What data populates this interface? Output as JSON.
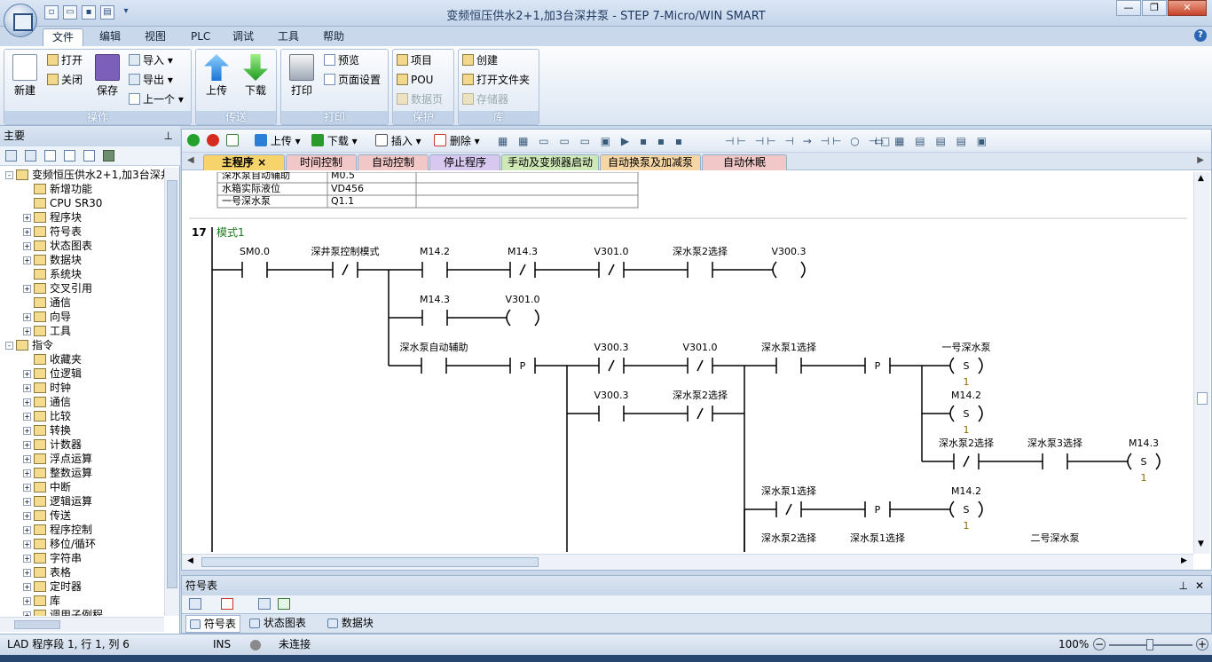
{
  "window": {
    "title": "变频恒压供水2+1,加3台深井泵 - STEP 7-Micro/WIN SMART"
  },
  "menu_tabs": [
    "文件",
    "编辑",
    "视图",
    "PLC",
    "调试",
    "工具",
    "帮助"
  ],
  "ribbon": {
    "groups": [
      {
        "title": "操作",
        "new": "新建",
        "open": "打开",
        "close": "关闭",
        "save": "保存",
        "import": "导入",
        "export": "导出",
        "previous": "上一个"
      },
      {
        "title": "传送",
        "upload": "上传",
        "download": "下载"
      },
      {
        "title": "打印",
        "print": "打印",
        "preview": "预览",
        "page_setup": "页面设置"
      },
      {
        "title": "保护",
        "project": "项目",
        "pou": "POU",
        "datapage": "数据页"
      },
      {
        "title": "库",
        "create": "创建",
        "open_folder": "打开文件夹",
        "memory": "存储器"
      }
    ]
  },
  "left_panel": {
    "title": "主要",
    "tree": [
      {
        "label": "变频恒压供水2+1,加3台深井",
        "level": 0,
        "exp": "-"
      },
      {
        "label": "新增功能",
        "level": 1,
        "exp": ""
      },
      {
        "label": "CPU SR30",
        "level": 1,
        "exp": ""
      },
      {
        "label": "程序块",
        "level": 1,
        "exp": "+"
      },
      {
        "label": "符号表",
        "level": 1,
        "exp": "+"
      },
      {
        "label": "状态图表",
        "level": 1,
        "exp": "+"
      },
      {
        "label": "数据块",
        "level": 1,
        "exp": "+"
      },
      {
        "label": "系统块",
        "level": 1,
        "exp": ""
      },
      {
        "label": "交叉引用",
        "level": 1,
        "exp": "+"
      },
      {
        "label": "通信",
        "level": 1,
        "exp": ""
      },
      {
        "label": "向导",
        "level": 1,
        "exp": "+"
      },
      {
        "label": "工具",
        "level": 1,
        "exp": "+"
      },
      {
        "label": "指令",
        "level": 0,
        "exp": "-"
      },
      {
        "label": "收藏夹",
        "level": 1,
        "exp": ""
      },
      {
        "label": "位逻辑",
        "level": 1,
        "exp": "+"
      },
      {
        "label": "时钟",
        "level": 1,
        "exp": "+"
      },
      {
        "label": "通信",
        "level": 1,
        "exp": "+"
      },
      {
        "label": "比较",
        "level": 1,
        "exp": "+"
      },
      {
        "label": "转换",
        "level": 1,
        "exp": "+"
      },
      {
        "label": "计数器",
        "level": 1,
        "exp": "+"
      },
      {
        "label": "浮点运算",
        "level": 1,
        "exp": "+"
      },
      {
        "label": "整数运算",
        "level": 1,
        "exp": "+"
      },
      {
        "label": "中断",
        "level": 1,
        "exp": "+"
      },
      {
        "label": "逻辑运算",
        "level": 1,
        "exp": "+"
      },
      {
        "label": "传送",
        "level": 1,
        "exp": "+"
      },
      {
        "label": "程序控制",
        "level": 1,
        "exp": "+"
      },
      {
        "label": "移位/循环",
        "level": 1,
        "exp": "+"
      },
      {
        "label": "字符串",
        "level": 1,
        "exp": "+"
      },
      {
        "label": "表格",
        "level": 1,
        "exp": "+"
      },
      {
        "label": "定时器",
        "level": 1,
        "exp": "+"
      },
      {
        "label": "库",
        "level": 1,
        "exp": "+"
      },
      {
        "label": "调用子例程",
        "level": 1,
        "exp": "+"
      }
    ]
  },
  "editor_toolbar": {
    "upload": "上传",
    "download": "下载",
    "insert": "插入",
    "delete": "删除"
  },
  "program_tabs": [
    {
      "label": "主程序",
      "color": "#f7d36b",
      "active": true
    },
    {
      "label": "时间控制",
      "color": "#f1c7c7",
      "active": false
    },
    {
      "label": "自动控制",
      "color": "#f1c7c7",
      "active": false
    },
    {
      "label": "停止程序",
      "color": "#d8c8f0",
      "active": false
    },
    {
      "label": "手动及变频器启动",
      "color": "#cfe8b7",
      "active": false
    },
    {
      "label": "自动换泵及加减泵",
      "color": "#f7d6a6",
      "active": false
    },
    {
      "label": "自动休眠",
      "color": "#f1c7c7",
      "active": false
    }
  ],
  "symbol_rows": [
    {
      "name": "深水泵自动辅助",
      "addr": "M0.5"
    },
    {
      "name": "水箱实际液位",
      "addr": "VD456"
    },
    {
      "name": "一号深水泵",
      "addr": "Q1.1"
    }
  ],
  "network": {
    "number": "17",
    "comment": "模式1"
  },
  "ladder_labels": {
    "sm00": "SM0.0",
    "mode_ctrl": "深井泵控制模式",
    "m142": "M14.2",
    "m143": "M14.3",
    "v3010": "V301.0",
    "pump2_sel": "深水泵2选择",
    "v3003": "V300.3",
    "aux": "深水泵自动辅助",
    "pump1_sel": "深水泵1选择",
    "pump3_sel": "深水泵3选择",
    "pump1": "一号深水泵",
    "pump2": "二号深水泵",
    "one": "1",
    "P": "P",
    "S": "S"
  },
  "bottom_panel": {
    "title": "符号表",
    "tabs": [
      "符号表",
      "状态图表",
      "数据块"
    ]
  },
  "status": {
    "position": "LAD 程序段 1, 行 1, 列 6",
    "mode": "INS",
    "connection": "未连接",
    "zoom": "100%"
  }
}
